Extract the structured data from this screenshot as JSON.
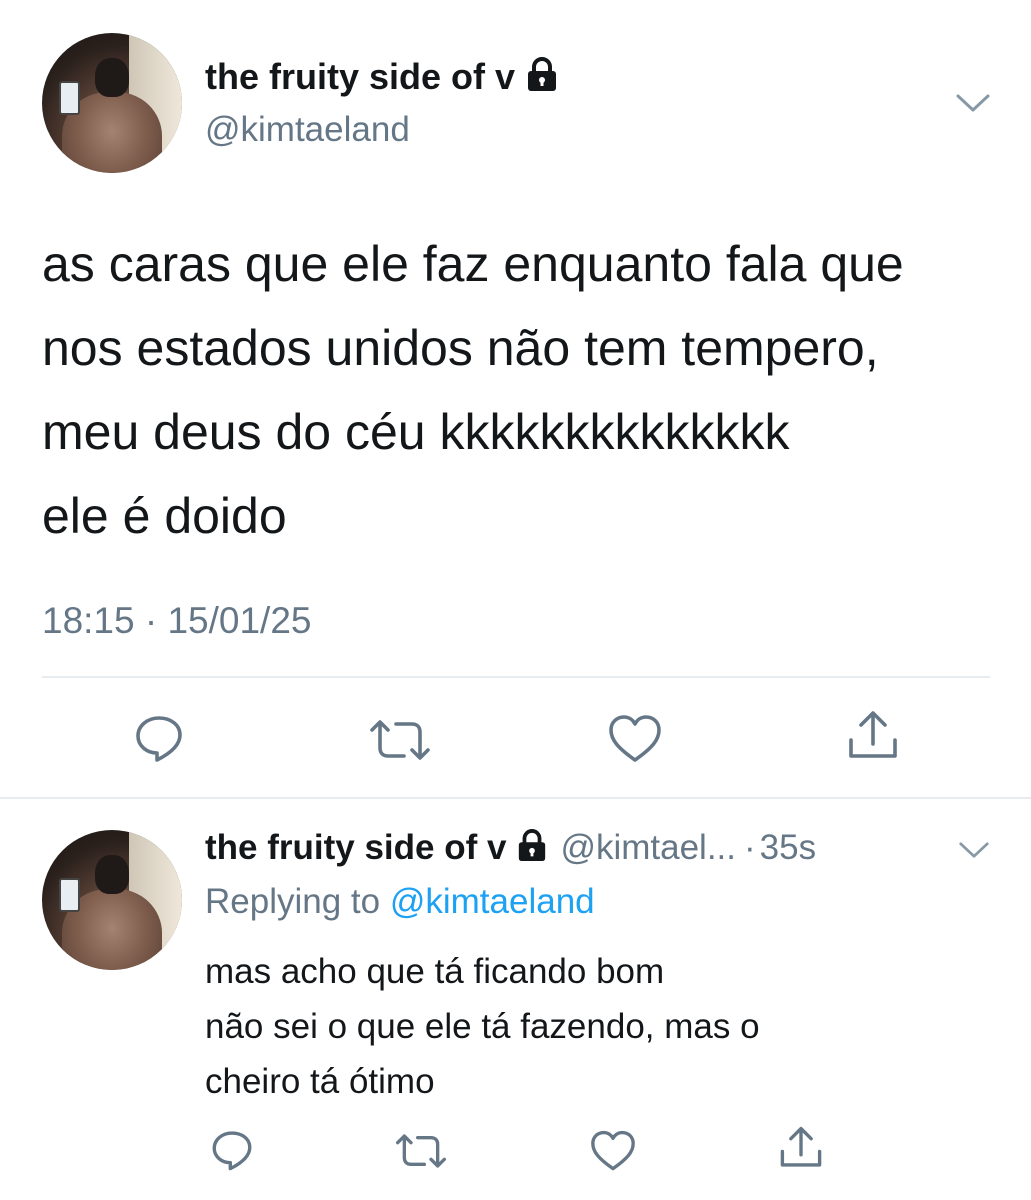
{
  "main_tweet": {
    "display_name": "the fruity side of v",
    "handle": "@kimtaeland",
    "text": "as caras que ele faz enquanto fala que\nnos estados unidos não tem tempero,\nmeu deus do céu kkkkkkkkkkkkkk\nele é doido",
    "timestamp": "18:15 · 15/01/25",
    "icons": {
      "lock": "lock-icon",
      "more": "chevron-down-icon",
      "reply": "reply-icon",
      "retweet": "retweet-icon",
      "like": "heart-icon",
      "share": "share-icon"
    }
  },
  "reply_tweet": {
    "display_name": "the fruity side of v",
    "handle": "@kimtael...",
    "separator": "·",
    "time_ago": "35s",
    "replying_prefix": "Replying to",
    "replying_to": "@kimtaeland",
    "text": "mas acho que tá ficando bom\nnão sei o que ele tá fazendo, mas o\ncheiro tá ótimo"
  },
  "colors": {
    "text_primary": "#14171a",
    "text_secondary": "#657786",
    "link": "#1da1f2",
    "divider": "#e6ecf0",
    "icon": "#657786"
  }
}
